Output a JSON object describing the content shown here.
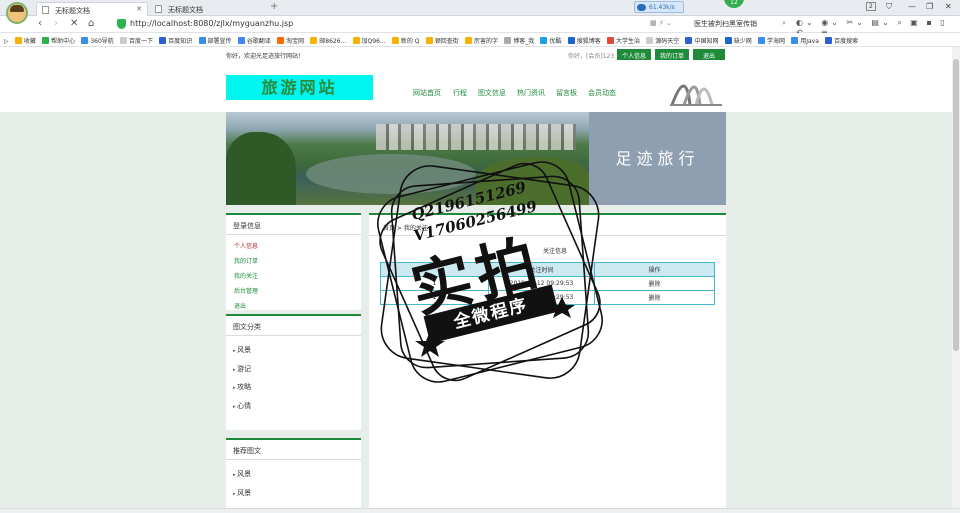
{
  "browser": {
    "tabs": [
      {
        "label": "无标题文档",
        "active": true
      },
      {
        "label": "无标题文档",
        "active": false
      }
    ],
    "url": "http://localhost:8080/zjlx/myguanzhu.jsp",
    "speed_badge": "61.43k/s",
    "notification_count": "12",
    "tab_count": "2",
    "search_text": "医生被判扫黑室传销",
    "bookmarks": [
      "收藏",
      "帮助中心",
      "360导航",
      "百度一下",
      "百度知识",
      "部署宣传",
      "谷歌翻译",
      "淘宝网",
      "邮8626...",
      "加Q96...",
      "新的 Q",
      "顿回查街",
      "厉害的字",
      "博客_我",
      "优酷",
      "搜狐博客",
      "大学生治",
      "源码天空",
      "中国知网",
      "缺少网",
      "学海网",
      "用Java",
      "百度搜索"
    ]
  },
  "site": {
    "welcome": "你好，欢迎光足迹旅行网站！",
    "user_info": "你好，[会员]123",
    "top_buttons": [
      "个人信息",
      "我的订单",
      "退出"
    ],
    "logo_text": "旅游网站",
    "nav": [
      "网站首页",
      "行程",
      "图文信息",
      "热门资讯",
      "留言板",
      "会员动态"
    ],
    "banner_slogan": "足迹旅行"
  },
  "sidebar": {
    "login_box": {
      "title": "登录信息",
      "links": [
        "个人信息",
        "我的订单",
        "我的关注",
        "后台管理",
        "退出"
      ]
    },
    "category_box": {
      "title": "图文分类",
      "items": [
        "风景",
        "游记",
        "攻略",
        "心情"
      ]
    },
    "recommend_box": {
      "title": "推荐图文",
      "items": [
        "风景",
        "风景"
      ]
    }
  },
  "content": {
    "breadcrumb": "首页 > 我的关注",
    "title": "关注信息",
    "table": {
      "headers": [
        "",
        "关注时间",
        "操作"
      ],
      "rows": [
        {
          "name": "1",
          "time": "2019-03-12 09:29:53",
          "action": "删除"
        },
        {
          "name": "1",
          "time": "2019-03-12 09:29:53",
          "action": "删除"
        }
      ]
    }
  },
  "watermark": {
    "qq_line": "Q2196151269",
    "phone_line": "V17060256499",
    "big_text": "实拍",
    "band_text": "全微程序"
  },
  "colors": {
    "brand_green": "#1f8b3a",
    "logo_bg": "#00f5f0",
    "table_border": "#45b8c8",
    "table_header": "#cce8f1",
    "page_bg": "#e7eeea"
  }
}
